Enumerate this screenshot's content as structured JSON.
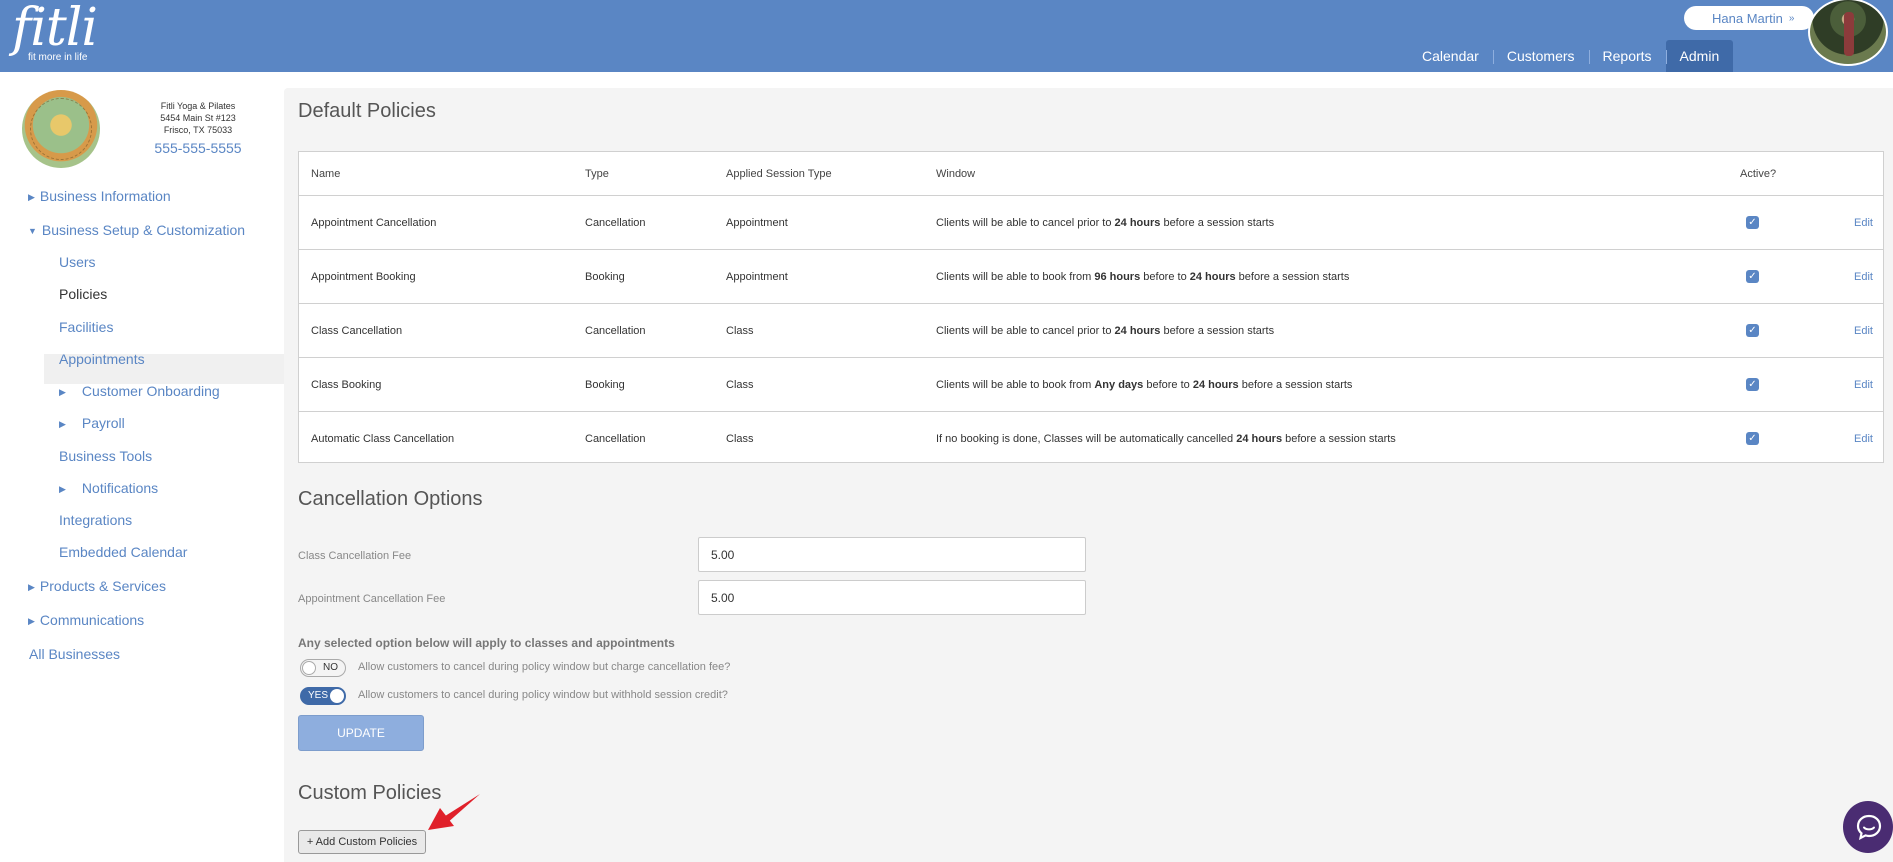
{
  "header": {
    "logo_text": "fitli",
    "logo_tagline": "fit more in life",
    "user_name": "Hana Martin",
    "user_menu_chevron": "»",
    "nav": [
      {
        "label": "Calendar"
      },
      {
        "label": "Customers"
      },
      {
        "label": "Reports"
      },
      {
        "label": "Admin",
        "active": true
      }
    ]
  },
  "business": {
    "name": "Fitli Yoga & Pilates",
    "address1": "5454 Main St #123",
    "address2": "Frisco, TX 75033",
    "phone": "555-555-5555"
  },
  "sidebar": {
    "items": [
      {
        "label": "Business Information",
        "expander": "collapsed"
      },
      {
        "label": "Business Setup & Customization",
        "expander": "expanded"
      },
      {
        "label": "Users"
      },
      {
        "label": "Policies",
        "active": true
      },
      {
        "label": "Facilities"
      },
      {
        "label": "Appointments"
      },
      {
        "label": "Customer Onboarding",
        "expander": "collapsed"
      },
      {
        "label": "Payroll",
        "expander": "collapsed"
      },
      {
        "label": "Business Tools"
      },
      {
        "label": "Notifications",
        "expander": "collapsed"
      },
      {
        "label": "Integrations"
      },
      {
        "label": "Embedded Calendar"
      },
      {
        "label": "Products & Services",
        "expander": "collapsed"
      },
      {
        "label": "Communications",
        "expander": "collapsed"
      },
      {
        "label": "All Businesses"
      }
    ]
  },
  "default_policies": {
    "title": "Default Policies",
    "columns": {
      "name": "Name",
      "type": "Type",
      "session_type": "Applied Session Type",
      "window": "Window",
      "active": "Active?"
    },
    "rows": [
      {
        "name": "Appointment Cancellation",
        "type": "Cancellation",
        "session_type": "Appointment",
        "window_parts": [
          "Clients will be able to cancel prior to ",
          "24 hours",
          " before a session starts"
        ],
        "active": true,
        "edit": "Edit"
      },
      {
        "name": "Appointment Booking",
        "type": "Booking",
        "session_type": "Appointment",
        "window_parts": [
          "Clients will be able to book from ",
          "96 hours",
          " before to ",
          "24 hours",
          " before a session starts"
        ],
        "active": true,
        "edit": "Edit"
      },
      {
        "name": "Class Cancellation",
        "type": "Cancellation",
        "session_type": "Class",
        "window_parts": [
          "Clients will be able to cancel prior to ",
          "24 hours",
          " before a session starts"
        ],
        "active": true,
        "edit": "Edit"
      },
      {
        "name": "Class Booking",
        "type": "Booking",
        "session_type": "Class",
        "window_parts": [
          "Clients will be able to book from ",
          "Any days",
          " before to ",
          "24 hours",
          " before a session starts"
        ],
        "active": true,
        "edit": "Edit"
      },
      {
        "name": "Automatic Class Cancellation",
        "type": "Cancellation",
        "session_type": "Class",
        "window_parts": [
          "If no booking is done, Classes will be automatically cancelled ",
          "24 hours",
          " before a session starts"
        ],
        "active": true,
        "edit": "Edit"
      }
    ]
  },
  "cancellation_options": {
    "title": "Cancellation Options",
    "class_fee_label": "Class Cancellation Fee",
    "class_fee_value": "5.00",
    "appointment_fee_label": "Appointment Cancellation Fee",
    "appointment_fee_value": "5.00",
    "note": "Any selected option below will apply to classes and appointments",
    "options": [
      {
        "state": "NO",
        "text": "Allow customers to cancel during policy window but charge cancellation fee?"
      },
      {
        "state": "YES",
        "text": "Allow customers to cancel during policy window but withhold session credit?"
      }
    ],
    "update_label": "UPDATE"
  },
  "custom_policies": {
    "title": "Custom Policies",
    "add_label": "+ Add Custom Policies"
  },
  "colors": {
    "brand": "#5a86c4",
    "brand_dark": "#3f6aa8",
    "arrow": "#e0202a",
    "chat": "#4a2c72"
  }
}
